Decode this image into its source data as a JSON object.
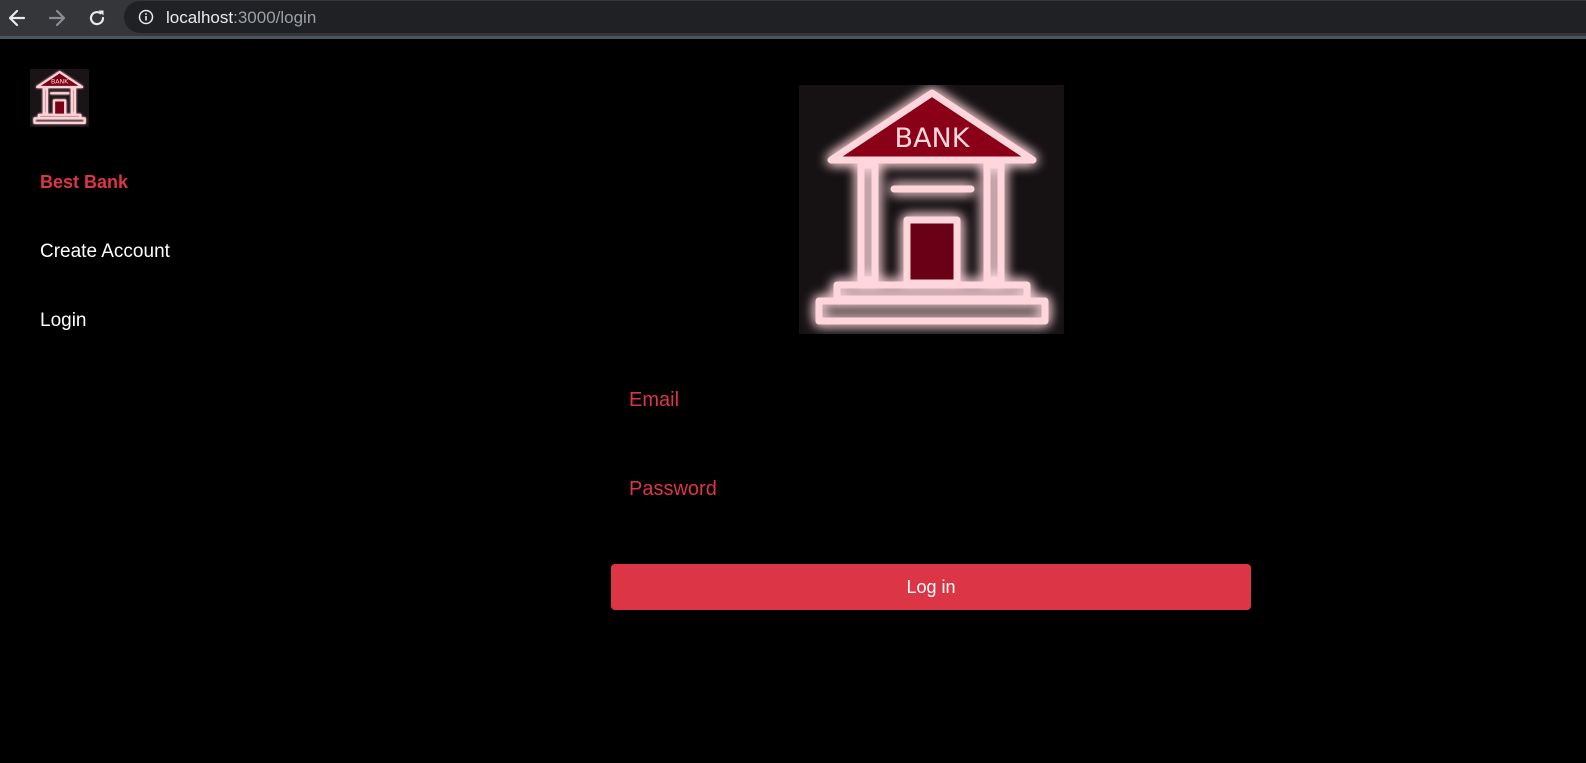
{
  "browser": {
    "url_host": "localhost",
    "url_path": ":3000/login",
    "icons": [
      "back-arrow-icon",
      "forward-arrow-icon",
      "reload-icon",
      "info-icon"
    ]
  },
  "sidebar": {
    "logo_text": "BANK",
    "brand": "Best Bank",
    "items": [
      {
        "label": "Create Account"
      },
      {
        "label": "Login"
      }
    ]
  },
  "main": {
    "logo_text": "BANK",
    "email_label": "Email",
    "password_label": "Password",
    "login_button": "Log in"
  },
  "colors": {
    "accent": "#dc3545",
    "background": "#000000",
    "neon": "#ff2a4d"
  }
}
